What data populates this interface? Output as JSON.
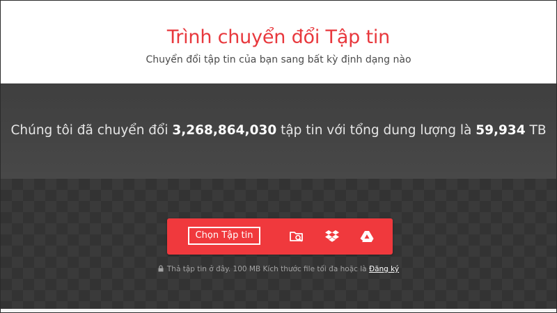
{
  "header": {
    "title": "Trình chuyển đổi Tập tin",
    "subtitle": "Chuyển đổi tập tin của bạn sang bất kỳ định dạng nào"
  },
  "stats": {
    "prefix": "Chúng tôi đã chuyển đổi",
    "file_count": "3,268,864,030",
    "middle": "tập tin với tổng dung lượng là",
    "total_size": "59,934",
    "unit": "TB"
  },
  "upload": {
    "choose_label": "Chọn Tập tin",
    "icons": [
      "folder-search-icon",
      "dropbox-icon",
      "google-drive-icon"
    ],
    "hint_text": "Thả tập tin ở đây. 100 MB Kích thước file tối đa hoặc là",
    "signup_label": "Đăng ký"
  },
  "colors": {
    "accent": "#e8383d",
    "upload_bar": "#f0393d",
    "dark_band": "#444444"
  }
}
